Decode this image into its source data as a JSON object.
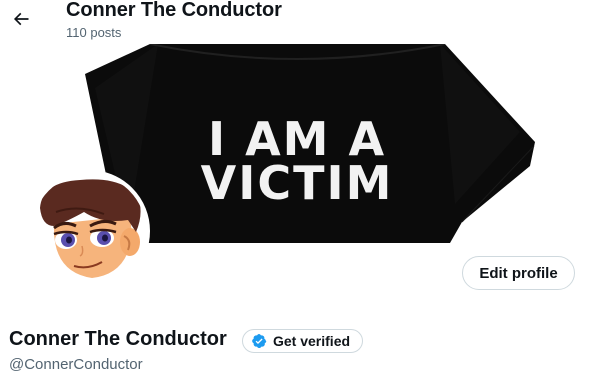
{
  "header": {
    "title": "Conner The Conductor",
    "post_count": "110 posts",
    "back_icon": "arrow-left-icon"
  },
  "banner": {
    "shirt_line1": "I AM A",
    "shirt_line2": "VICTIM",
    "shirt_color": "#0b0b0b"
  },
  "profile": {
    "display_name": "Conner The Conductor",
    "handle": "@ConnerConductor",
    "edit_label": "Edit profile",
    "verify_label": "Get verified",
    "verify_icon": "verified-badge-icon",
    "accent": "#1d9bf0"
  }
}
